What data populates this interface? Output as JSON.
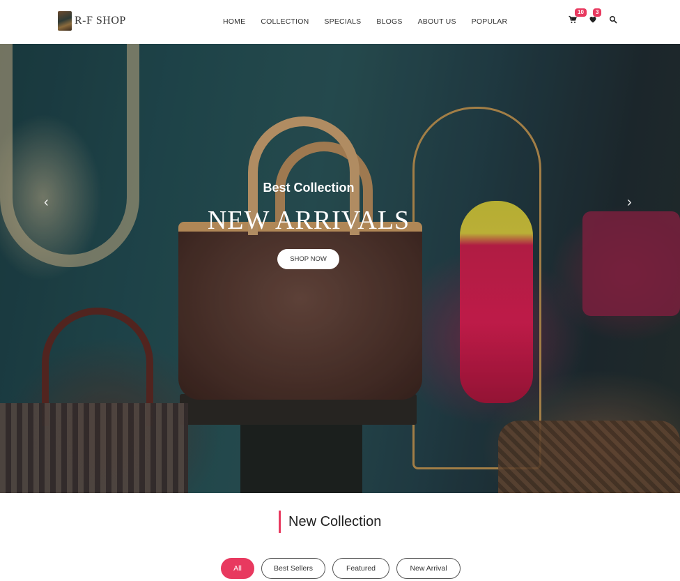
{
  "header": {
    "logo_text": "R-F SHOP",
    "nav": [
      "HOME",
      "COLLECTION",
      "SPECIALS",
      "BLOGS",
      "ABOUT US",
      "POPULAR"
    ],
    "cart_icon": "cart-icon",
    "cart_count": "10",
    "wishlist_icon": "heart-icon",
    "wishlist_count": "3",
    "search_icon": "search-icon"
  },
  "hero": {
    "subtitle": "Best Collection",
    "title": "NEW ARRIVALS",
    "button_label": "SHOP NOW",
    "prev_icon": "chevron-left-icon",
    "next_icon": "chevron-right-icon"
  },
  "collection": {
    "title": "New Collection",
    "filters": [
      "All",
      "Best Sellers",
      "Featured",
      "New Arrival"
    ],
    "active_filter": "All"
  },
  "colors": {
    "accent": "#e8395f",
    "text": "#222222",
    "background": "#ffffff"
  }
}
